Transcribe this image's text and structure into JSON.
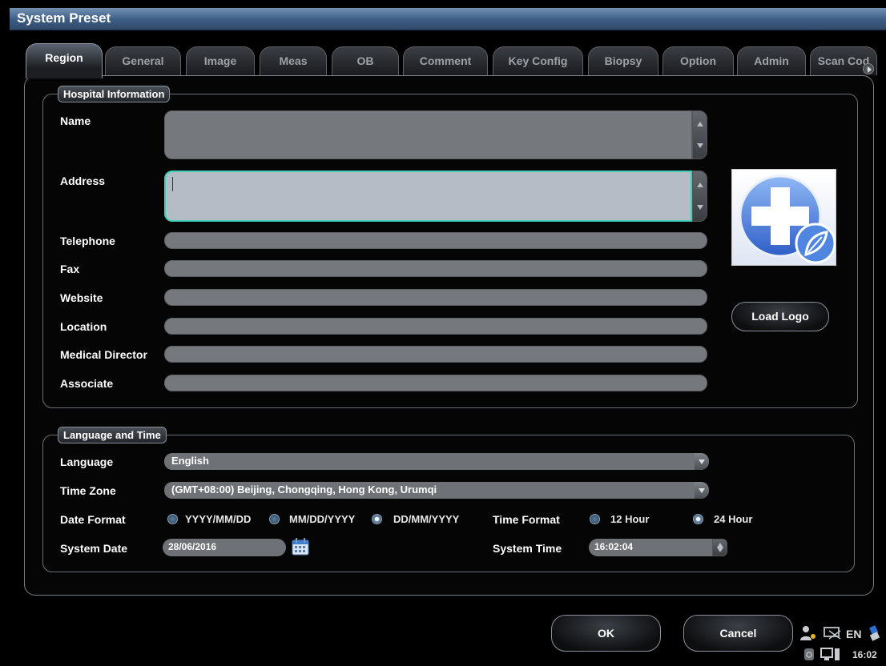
{
  "window": {
    "title": "System Preset"
  },
  "tabs": [
    "Region",
    "General",
    "Image",
    "Meas",
    "OB",
    "Comment",
    "Key Config",
    "Biopsy",
    "Option",
    "Admin",
    "Scan Cod"
  ],
  "hospital": {
    "legend": "Hospital Information",
    "name_label": "Name",
    "address_label": "Address",
    "telephone_label": "Telephone",
    "fax_label": "Fax",
    "website_label": "Website",
    "location_label": "Location",
    "director_label": "Medical Director",
    "associate_label": "Associate",
    "load_logo": "Load Logo"
  },
  "lang_time": {
    "legend": "Language and Time",
    "language_label": "Language",
    "language_value": "English",
    "timezone_label": "Time Zone",
    "timezone_value": "(GMT+08:00) Beijing, Chongqing, Hong Kong, Urumqi",
    "date_format_label": "Date Format",
    "date_formats": [
      "YYYY/MM/DD",
      "MM/DD/YYYY",
      "DD/MM/YYYY"
    ],
    "date_format_selected": "DD/MM/YYYY",
    "time_format_label": "Time Format",
    "time_formats": [
      "12 Hour",
      "24 Hour"
    ],
    "time_format_selected": "24 Hour",
    "system_date_label": "System Date",
    "system_date_value": "28/06/2016",
    "system_time_label": "System Time",
    "system_time_value": "16:02:04"
  },
  "buttons": {
    "ok": "OK",
    "cancel": "Cancel"
  },
  "status": {
    "lang": "EN",
    "clock": "16:02"
  },
  "colors": {
    "title_bar": "#3e5c82",
    "focus_border": "#3fd0b8",
    "logo_blue": "#4f86e0"
  }
}
